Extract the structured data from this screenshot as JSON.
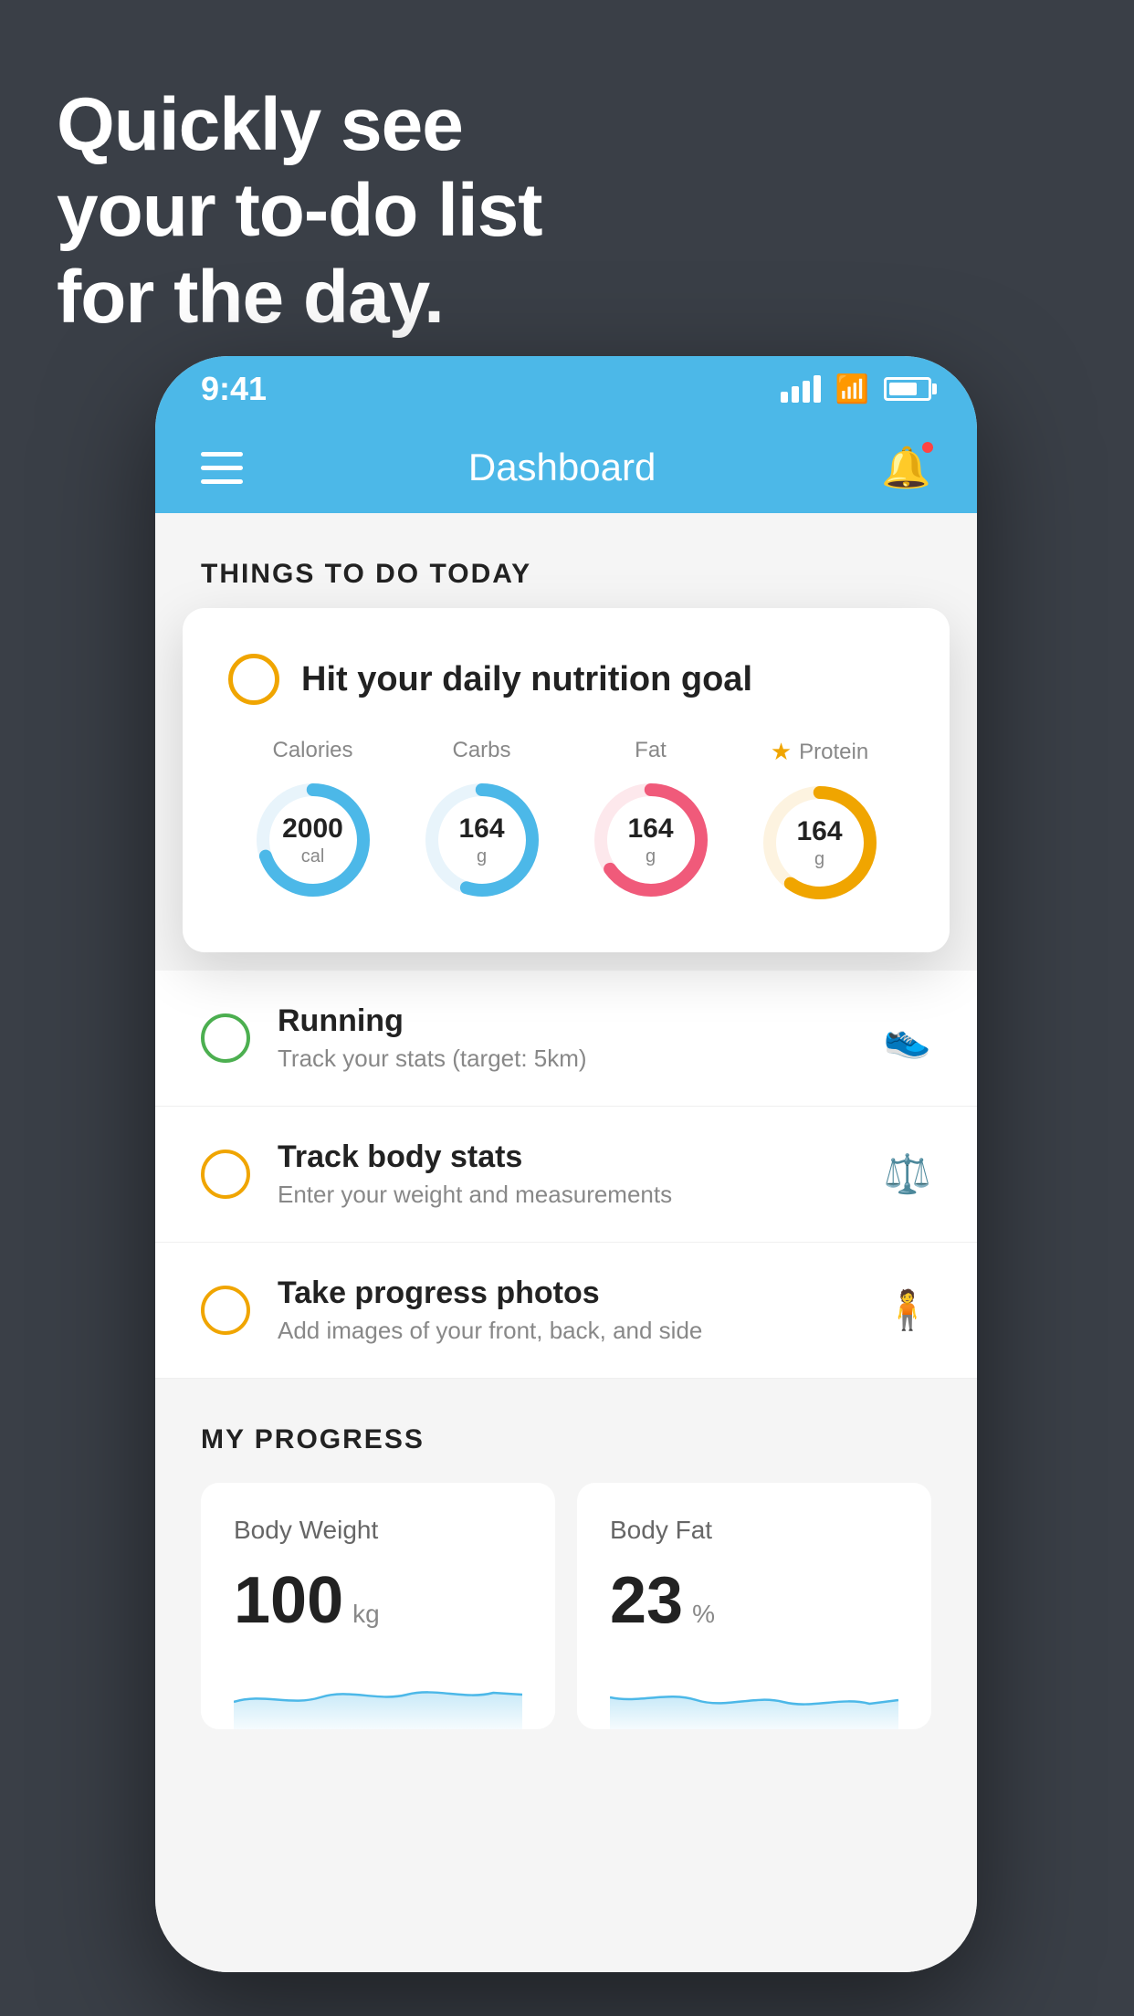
{
  "headline": {
    "line1": "Quickly see",
    "line2": "your to-do list",
    "line3": "for the day."
  },
  "statusBar": {
    "time": "9:41"
  },
  "navbar": {
    "title": "Dashboard"
  },
  "thingsSection": {
    "title": "THINGS TO DO TODAY"
  },
  "nutritionCard": {
    "title": "Hit your daily nutrition goal",
    "calories": {
      "label": "Calories",
      "value": "2000",
      "unit": "cal",
      "color": "#4cb8e8",
      "percent": 70
    },
    "carbs": {
      "label": "Carbs",
      "value": "164",
      "unit": "g",
      "color": "#4cb8e8",
      "percent": 55
    },
    "fat": {
      "label": "Fat",
      "value": "164",
      "unit": "g",
      "color": "#f05a7a",
      "percent": 65
    },
    "protein": {
      "label": "Protein",
      "value": "164",
      "unit": "g",
      "color": "#f0a500",
      "percent": 60,
      "starred": true
    }
  },
  "todoItems": [
    {
      "title": "Running",
      "subtitle": "Track your stats (target: 5km)",
      "circleColor": "green",
      "icon": "shoe"
    },
    {
      "title": "Track body stats",
      "subtitle": "Enter your weight and measurements",
      "circleColor": "yellow",
      "icon": "scale"
    },
    {
      "title": "Take progress photos",
      "subtitle": "Add images of your front, back, and side",
      "circleColor": "yellow",
      "icon": "person"
    }
  ],
  "progressSection": {
    "title": "MY PROGRESS",
    "bodyWeight": {
      "label": "Body Weight",
      "value": "100",
      "unit": "kg"
    },
    "bodyFat": {
      "label": "Body Fat",
      "value": "23",
      "unit": "%"
    }
  }
}
